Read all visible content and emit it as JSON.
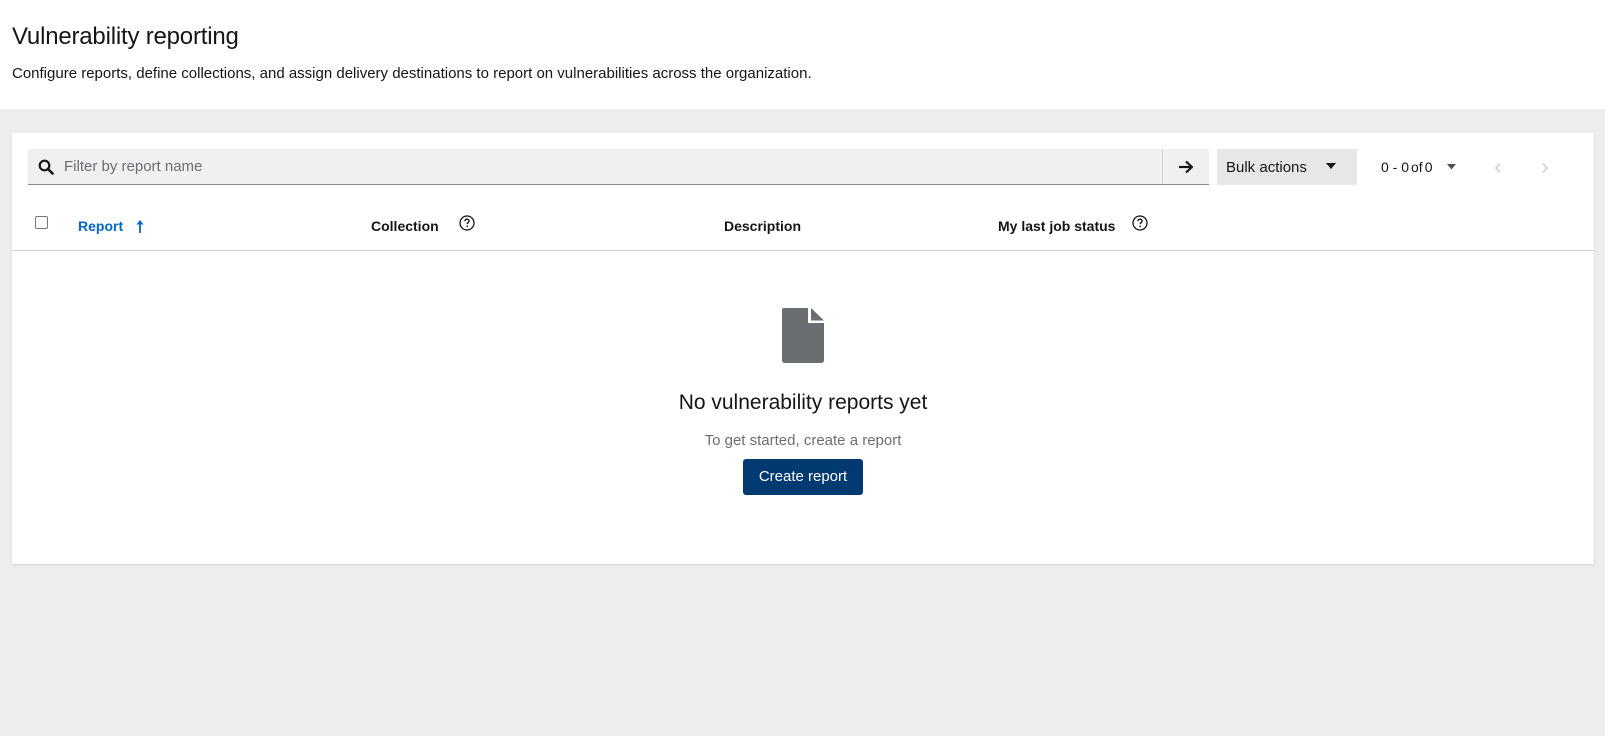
{
  "header": {
    "title": "Vulnerability reporting",
    "subtitle": "Configure reports, define collections, and assign delivery destinations to report on vulnerabilities across the organization."
  },
  "toolbar": {
    "search_placeholder": "Filter by report name",
    "search_value": "",
    "bulk_actions_label": "Bulk actions",
    "pagination": {
      "range": "0 - 0",
      "of_label": "of",
      "total": "0"
    }
  },
  "table": {
    "columns": [
      {
        "label": "Report",
        "sorted": "ascending"
      },
      {
        "label": "Collection",
        "has_help": true
      },
      {
        "label": "Description"
      },
      {
        "label": "My last job status",
        "has_help": true
      }
    ],
    "rows": []
  },
  "empty_state": {
    "icon": "file-icon",
    "title": "No vulnerability reports yet",
    "body": "To get started, create a report",
    "button_label": "Create report"
  },
  "colors": {
    "page_bg": "#ededed",
    "link": "#0066cc",
    "primary_button": "#003a70",
    "icon_gray": "#6a6e73"
  }
}
